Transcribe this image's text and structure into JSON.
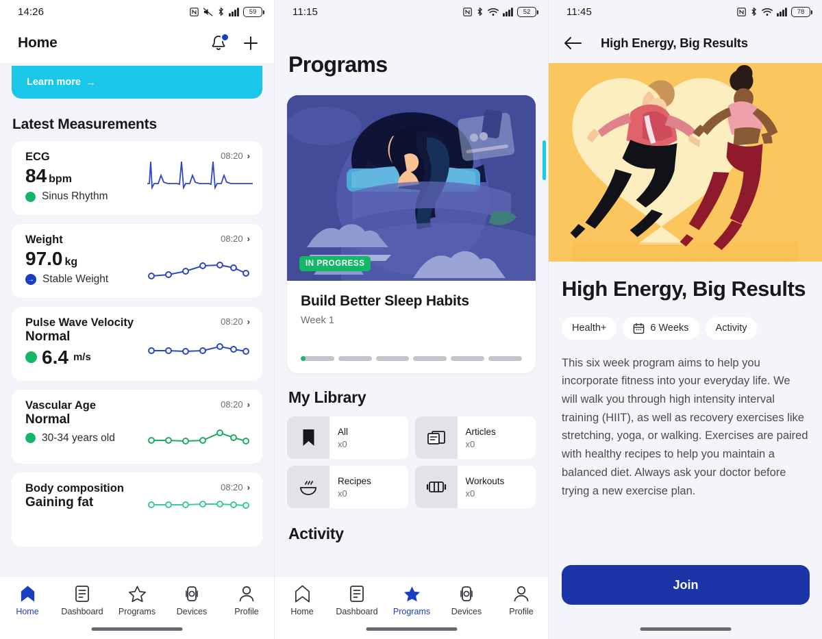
{
  "screens": {
    "home": {
      "status": {
        "time": "14:26",
        "battery": "59",
        "icons": [
          "nfc-icon",
          "mute-icon",
          "bluetooth-icon",
          "signal-icon",
          "battery-icon"
        ]
      },
      "appbar": {
        "title": "Home",
        "bell_icon": "bell-icon",
        "add_icon": "plus-icon"
      },
      "banner": {
        "label": "Learn more",
        "arrow": "→",
        "color": "#19c8e8"
      },
      "section_title": "Latest Measurements",
      "measurements": [
        {
          "name": "ECG",
          "time": "08:20",
          "value": "84",
          "unit": "bpm",
          "status": "Sinus Rhythm",
          "status_color": "#13b765",
          "chart": "ecg-waveform"
        },
        {
          "name": "Weight",
          "time": "08:20",
          "value": "97.0",
          "unit": "kg",
          "status": "Stable Weight",
          "status_color": "#1a3ec2",
          "chart": "line-sparkline"
        },
        {
          "name": "Pulse Wave Velocity",
          "time": "08:20",
          "headline": "Normal",
          "value": "6.4",
          "unit": "m/s",
          "status_color": "#13b765",
          "chart": "line-sparkline"
        },
        {
          "name": "Vascular Age",
          "time": "08:20",
          "headline": "Normal",
          "status": "30-34 years old",
          "status_color": "#13b765",
          "chart": "line-sparkline"
        },
        {
          "name": "Body composition",
          "time": "08:20",
          "headline": "Gaining fat",
          "chart": "line-sparkline"
        }
      ],
      "nav": {
        "active": "Programs",
        "items": [
          {
            "label": "Home",
            "icon": "home-icon",
            "active": true
          },
          {
            "label": "Dashboard",
            "icon": "dashboard-icon",
            "active": false
          },
          {
            "label": "Programs",
            "icon": "star-icon",
            "active": false
          },
          {
            "label": "Devices",
            "icon": "watch-icon",
            "active": false
          },
          {
            "label": "Profile",
            "icon": "person-icon",
            "active": false
          }
        ]
      }
    },
    "programs": {
      "status": {
        "time": "11:15",
        "battery": "52"
      },
      "title": "Programs",
      "card": {
        "badge": "IN PROGRESS",
        "name": "Build Better Sleep Habits",
        "week": "Week 1",
        "progress_segments": 6,
        "progress_fill_percent": 12,
        "illustration": "sleeping-woman-illustration"
      },
      "library_title": "My Library",
      "library": [
        {
          "label": "All",
          "count": "x0",
          "icon": "bookmark-icon"
        },
        {
          "label": "Articles",
          "count": "x0",
          "icon": "articles-icon"
        },
        {
          "label": "Recipes",
          "count": "x0",
          "icon": "bowl-icon"
        },
        {
          "label": "Workouts",
          "count": "x0",
          "icon": "dumbbell-icon"
        }
      ],
      "activity_title": "Activity",
      "nav": {
        "items": [
          {
            "label": "Home",
            "icon": "home-icon",
            "active": false
          },
          {
            "label": "Dashboard",
            "icon": "dashboard-icon",
            "active": false
          },
          {
            "label": "Programs",
            "icon": "star-icon",
            "active": true
          },
          {
            "label": "Devices",
            "icon": "watch-icon",
            "active": false
          },
          {
            "label": "Profile",
            "icon": "person-icon",
            "active": false
          }
        ]
      }
    },
    "detail": {
      "status": {
        "time": "11:45",
        "battery": "78"
      },
      "back_icon": "arrow-left-icon",
      "bar_title": "High Energy, Big Results",
      "hero_illustration": "two-runners-illustration",
      "heading": "High Energy, Big Results",
      "chips": [
        {
          "label": "Health+",
          "icon": null
        },
        {
          "label": "6 Weeks",
          "icon": "calendar-icon"
        },
        {
          "label": "Activity",
          "icon": null
        }
      ],
      "description": "This six week program aims to help you incorporate fitness into your everyday life. We will walk you through high intensity interval training (HIIT), as well as recovery exercises like stretching, yoga, or walking. Exercises are paired with healthy recipes to help you maintain a balanced diet. Always ask your doctor before trying a new exercise plan.",
      "join_label": "Join"
    }
  },
  "colors": {
    "primary": "#1a3ec2",
    "join": "#1b35a8",
    "accent_cyan": "#19c8e8",
    "green": "#13b765",
    "hero_yellow": "#fbc65e",
    "card_navy": "#434c99"
  }
}
